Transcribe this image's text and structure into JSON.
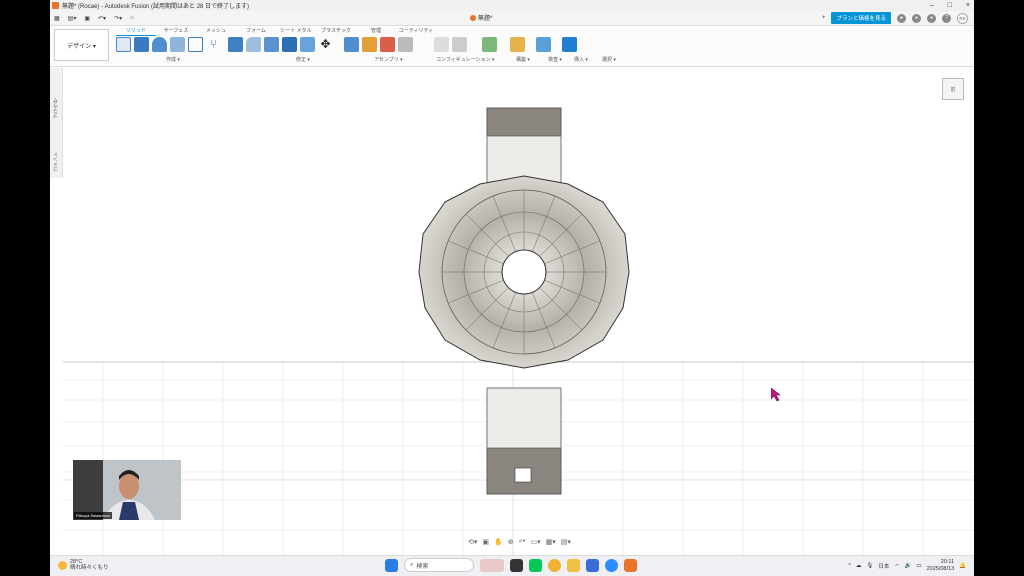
{
  "window": {
    "title": "無題* (Rocae) - Autodesk Fusion (試用期間はあと 28 日で終了します)",
    "minimize": "–",
    "maximize": "□",
    "close": "×"
  },
  "quick_access": {
    "document_tab": "無題*",
    "new_tab": "+",
    "pricing_button": "プランと価格を見る",
    "avatar_initials": "RS"
  },
  "ribbon": {
    "design_button": "デザイン ▾",
    "tabs": [
      {
        "label": "ソリッド",
        "active": true
      },
      {
        "label": "サーフェス",
        "active": false
      },
      {
        "label": "メッシュ",
        "active": false
      },
      {
        "label": "フォーム",
        "active": false
      },
      {
        "label": "シート メタル",
        "active": false
      },
      {
        "label": "プラスチック",
        "active": false
      },
      {
        "label": "管理",
        "active": false
      },
      {
        "label": "ユーティリティ",
        "active": false
      }
    ],
    "groups": [
      {
        "label": "作成 ▾"
      },
      {
        "label": "修正 ▾"
      },
      {
        "label": "アセンブリ ▾"
      },
      {
        "label": "コンフィギュレーション ▾"
      },
      {
        "label": "構築 ▾"
      },
      {
        "label": "検査 ▾"
      },
      {
        "label": "挿入 ▾"
      },
      {
        "label": "選択 ▾"
      }
    ]
  },
  "side_panel": {
    "browser_label": "ブラウザ",
    "comments_label": "コメント"
  },
  "viewport": {
    "viewcube_label": "前"
  },
  "webcam": {
    "name": "Ritsuya Sawamura"
  },
  "taskbar": {
    "weather_temp": "28°C",
    "weather_desc": "晴れ時々くもり",
    "search_placeholder": "検索",
    "ime": "日本",
    "time": "20:11",
    "date": "2025/08/13"
  },
  "colors": {
    "accent": "#0696d7",
    "app_orange": "#e8742a",
    "cursor": "#c0168a"
  }
}
